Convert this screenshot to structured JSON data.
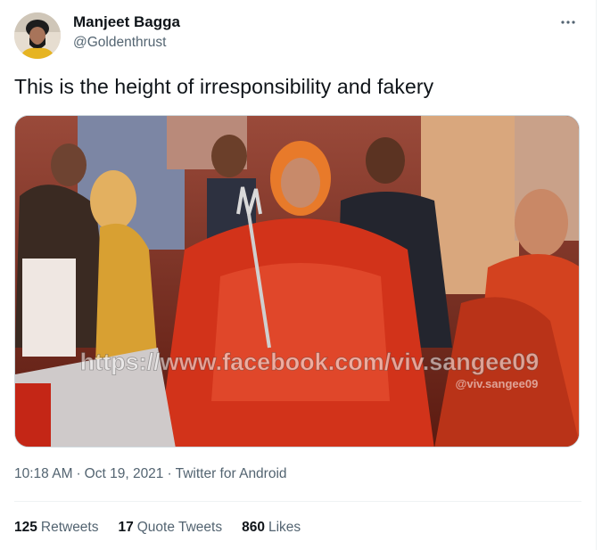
{
  "user": {
    "name": "Manjeet Bagga",
    "handle": "@Goldenthrust"
  },
  "tweet": {
    "text": "This is the height of irresponsibility and fakery",
    "time": "10:18 AM",
    "date": "Oct 19, 2021",
    "source": "Twitter for Android",
    "separator": "·"
  },
  "media": {
    "watermark_main": "https://www.facebook.com/viv.sangee09",
    "watermark_small": "@viv.sangee09"
  },
  "stats": [
    {
      "count": "125",
      "label": "Retweets"
    },
    {
      "count": "17",
      "label": "Quote Tweets"
    },
    {
      "count": "860",
      "label": "Likes"
    }
  ],
  "icons": {
    "more": "more-horizontal-icon"
  }
}
